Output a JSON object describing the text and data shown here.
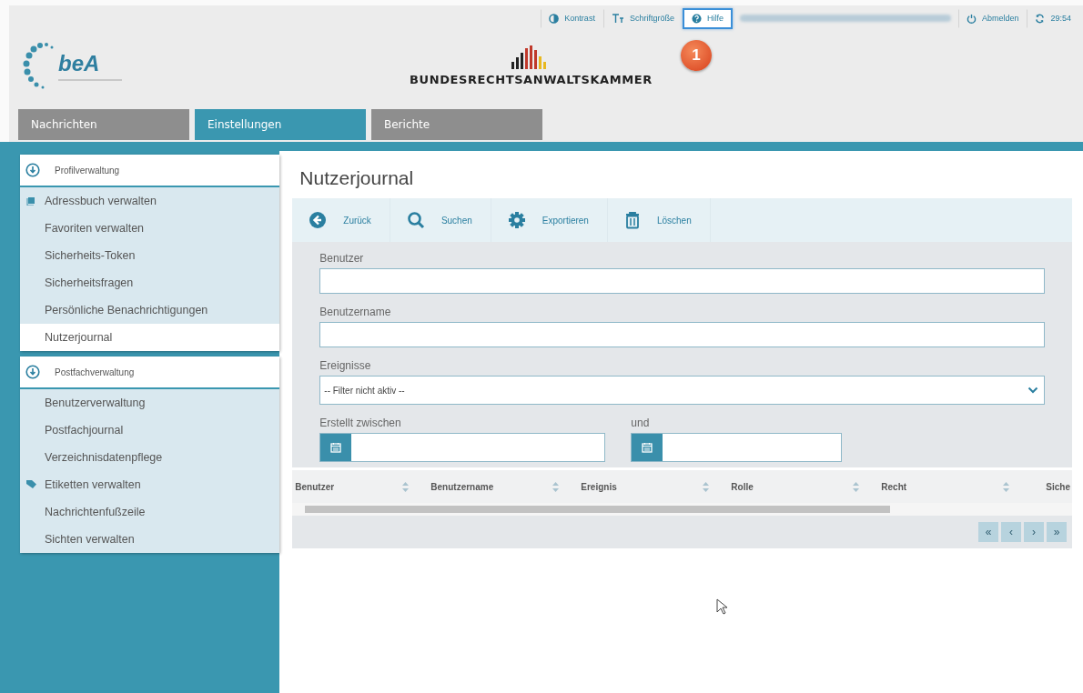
{
  "topbar": [
    {
      "kind": "contrast",
      "label": "Kontrast",
      "highlighted": false
    },
    {
      "kind": "font",
      "label": "Schriftgröße",
      "highlighted": false
    },
    {
      "kind": "help",
      "label": "Hilfe",
      "highlighted": true
    },
    {
      "kind": "blurred"
    },
    {
      "kind": "power",
      "label": "Abmelden",
      "highlighted": false
    },
    {
      "kind": "refresh",
      "label": "29:54",
      "highlighted": false
    }
  ],
  "badge": "1",
  "logo": {
    "text": "beA"
  },
  "brand": "BUNDESRECHTSANWALTSKAMMER",
  "tabs": [
    {
      "label": "Nachrichten",
      "selected": false
    },
    {
      "label": "Einstellungen",
      "selected": true
    },
    {
      "label": "Berichte",
      "selected": false
    }
  ],
  "sidebar": [
    {
      "title": "Profilverwaltung",
      "items": [
        {
          "label": "Adressbuch verwalten",
          "kind": "book",
          "selected": false
        },
        {
          "label": "Favoriten verwalten",
          "kind": "plain",
          "selected": false
        },
        {
          "label": "Sicherheits-Token",
          "kind": "plain",
          "selected": false
        },
        {
          "label": "Sicherheitsfragen",
          "kind": "plain",
          "selected": false
        },
        {
          "label": "Persönliche Benachrichtigungen",
          "kind": "plain",
          "selected": false
        },
        {
          "label": "Nutzerjournal",
          "kind": "plain",
          "selected": true
        }
      ]
    },
    {
      "title": "Postfachverwaltung",
      "items": [
        {
          "label": "Benutzerverwaltung",
          "kind": "plain",
          "selected": false
        },
        {
          "label": "Postfachjournal",
          "kind": "plain",
          "selected": false
        },
        {
          "label": "Verzeichnisdatenpflege",
          "kind": "plain",
          "selected": false
        },
        {
          "label": "Etiketten verwalten",
          "kind": "tag",
          "selected": false
        },
        {
          "label": "Nachrichtenfußzeile",
          "kind": "plain",
          "selected": false
        },
        {
          "label": "Sichten verwalten",
          "kind": "plain",
          "selected": false
        }
      ]
    }
  ],
  "page_title": "Nutzerjournal",
  "toolbar": [
    {
      "kind": "back",
      "label": "Zurück"
    },
    {
      "kind": "search",
      "label": "Suchen"
    },
    {
      "kind": "gear",
      "label": "Exportieren"
    },
    {
      "kind": "trash",
      "label": "Löschen"
    }
  ],
  "form": {
    "user_label": "Benutzer",
    "username_label": "Benutzername",
    "events_label": "Ereignisse",
    "events_value": "-- Filter nicht aktiv --",
    "from_label": "Erstellt zwischen",
    "to_label": "und"
  },
  "table": {
    "columns": [
      "Benutzer",
      "Benutzername",
      "Ereignis",
      "Rolle",
      "Recht",
      "Siche"
    ]
  },
  "pager": [
    {
      "label": "«",
      "disabled": true
    },
    {
      "label": "‹",
      "disabled": true
    },
    {
      "label": "›",
      "disabled": true
    },
    {
      "label": "»",
      "disabled": true
    }
  ]
}
